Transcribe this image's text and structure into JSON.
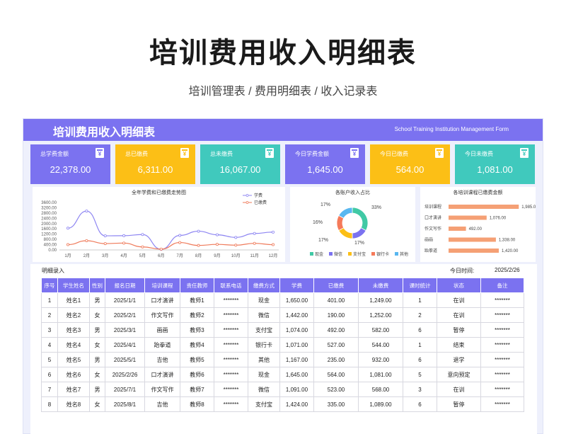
{
  "title": "培训费用收入明细表",
  "subtitle": "培训管理表 / 费用明细表 / 收入记录表",
  "banner": {
    "title": "培训费用收入明细表",
    "en": "School Training Institution Management Form"
  },
  "colors": {
    "purple": "#7b72f0",
    "yellow": "#fcbf16",
    "teal": "#40c9bd",
    "orange": "#f5a075"
  },
  "cards": [
    {
      "label": "总学费金额",
      "value": "22,378.00",
      "color": "#7b72f0",
      "icon": "receipt-icon"
    },
    {
      "label": "总已缴费",
      "value": "6,311.00",
      "color": "#fcbf16",
      "icon": "receipt-icon"
    },
    {
      "label": "总未缴费",
      "value": "16,067.00",
      "color": "#40c9bd",
      "icon": "receipt-icon"
    },
    {
      "label": "今日学费金额",
      "value": "1,645.00",
      "color": "#7b72f0",
      "icon": "receipt-icon"
    },
    {
      "label": "今日已缴费",
      "value": "564.00",
      "color": "#fcbf16",
      "icon": "receipt-icon"
    },
    {
      "label": "今日未缴费",
      "value": "1,081.00",
      "color": "#40c9bd",
      "icon": "receipt-icon"
    }
  ],
  "chart_data": [
    {
      "type": "line",
      "title": "全年学费和已缴费走势图",
      "categories": [
        "1月",
        "2月",
        "3月",
        "4月",
        "5月",
        "6月",
        "7月",
        "8月",
        "9月",
        "10月",
        "11月",
        "12月"
      ],
      "series": [
        {
          "name": "学费",
          "color": "#8e86f2",
          "values": [
            1650,
            2950,
            1070,
            1080,
            1170,
            50,
            1100,
            1420,
            1150,
            950,
            1250,
            1350
          ]
        },
        {
          "name": "已缴费",
          "color": "#ef7a5a",
          "values": [
            400,
            700,
            480,
            520,
            230,
            60,
            560,
            340,
            420,
            360,
            500,
            400
          ]
        }
      ],
      "ylim": [
        0,
        3600
      ],
      "yticks": [
        "3600.00",
        "3200.00",
        "2800.00",
        "2400.00",
        "2000.00",
        "1600.00",
        "1200.00",
        "800.00",
        "400.00",
        "0.00"
      ],
      "legend": "top-right"
    },
    {
      "type": "pie",
      "title": "各账户收入占比",
      "slices": [
        {
          "name": "现金",
          "value": 33,
          "label": "33%",
          "color": "#40c9a5"
        },
        {
          "name": "微信",
          "value": 17,
          "label": "17%",
          "color": "#7b72f0"
        },
        {
          "name": "支付宝",
          "value": 17,
          "label": "17%",
          "color": "#fcbf16"
        },
        {
          "name": "银行卡",
          "value": 16,
          "label": "16%",
          "color": "#f57a5a"
        },
        {
          "name": "其他",
          "value": 17,
          "label": "17%",
          "color": "#58b7f0"
        }
      ],
      "legend": "bottom"
    },
    {
      "type": "bar",
      "orientation": "horizontal",
      "title": "各培训课程已缴费金额",
      "categories": [
        "培训课程",
        "口才演讲",
        "作文写作",
        "画画",
        "跆拳道"
      ],
      "values": [
        1985,
        1076,
        492,
        1338,
        1420
      ],
      "labels": [
        "1,985.00",
        "1,076.00",
        "492.00",
        "1,338.00",
        "1,420.00"
      ],
      "color": "#f5a075",
      "xlim": [
        0,
        2400
      ]
    }
  ],
  "table": {
    "label": "明细录入",
    "date_label": "今日时间:",
    "date": "2025/2/26",
    "headers": [
      "序号",
      "学生姓名",
      "性别",
      "报名日期",
      "培训课程",
      "责任教师",
      "联系电话",
      "缴费方式",
      "学费",
      "已缴费",
      "未缴费",
      "课时统计",
      "状态",
      "备注"
    ],
    "rows": [
      [
        "1",
        "姓名1",
        "男",
        "2025/1/1",
        "口才演讲",
        "教师1",
        "*******",
        "现金",
        "1,650.00",
        "401.00",
        "1,249.00",
        "1",
        "在训",
        "*******"
      ],
      [
        "2",
        "姓名2",
        "女",
        "2025/2/1",
        "作文写作",
        "教师2",
        "*******",
        "微信",
        "1,442.00",
        "190.00",
        "1,252.00",
        "2",
        "在训",
        "*******"
      ],
      [
        "3",
        "姓名3",
        "男",
        "2025/3/1",
        "画画",
        "教师3",
        "*******",
        "支付宝",
        "1,074.00",
        "492.00",
        "582.00",
        "6",
        "暂停",
        "*******"
      ],
      [
        "4",
        "姓名4",
        "女",
        "2025/4/1",
        "跆拳道",
        "教师4",
        "*******",
        "银行卡",
        "1,071.00",
        "527.00",
        "544.00",
        "1",
        "结束",
        "*******"
      ],
      [
        "5",
        "姓名5",
        "男",
        "2025/5/1",
        "吉他",
        "教师5",
        "*******",
        "其他",
        "1,167.00",
        "235.00",
        "932.00",
        "6",
        "退学",
        "*******"
      ],
      [
        "6",
        "姓名6",
        "女",
        "2025/2/26",
        "口才演讲",
        "教师6",
        "*******",
        "现金",
        "1,645.00",
        "564.00",
        "1,081.00",
        "5",
        "意向预定",
        "*******"
      ],
      [
        "7",
        "姓名7",
        "男",
        "2025/7/1",
        "作文写作",
        "教师7",
        "*******",
        "微信",
        "1,091.00",
        "523.00",
        "568.00",
        "3",
        "在训",
        "*******"
      ],
      [
        "8",
        "姓名8",
        "女",
        "2025/8/1",
        "吉他",
        "教师8",
        "*******",
        "支付宝",
        "1,424.00",
        "335.00",
        "1,089.00",
        "6",
        "暂停",
        "*******"
      ]
    ]
  }
}
